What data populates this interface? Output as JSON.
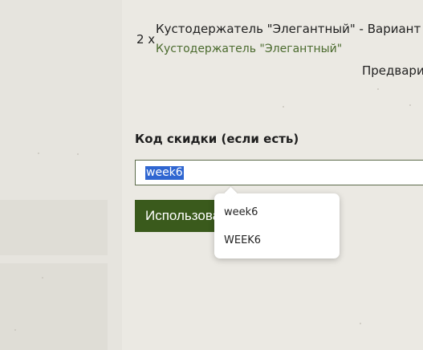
{
  "order": {
    "quantity": "2 x",
    "product_name": "Кустодержатель \"Элегантный\" - Вариант",
    "product_link": "Кустодержатель \"Элегантный\"",
    "preview_label": "Предвари"
  },
  "coupon": {
    "label": "Код скидки (если есть)",
    "value": "week6",
    "apply_label": "Использовать"
  },
  "autocomplete": {
    "options": [
      "week6",
      "WEEK6"
    ]
  },
  "colors": {
    "page_bg": "#ebe9e3",
    "link_green": "#4a6a2d",
    "button_green": "#3a5a1c",
    "selection_blue": "#2f66d1"
  }
}
